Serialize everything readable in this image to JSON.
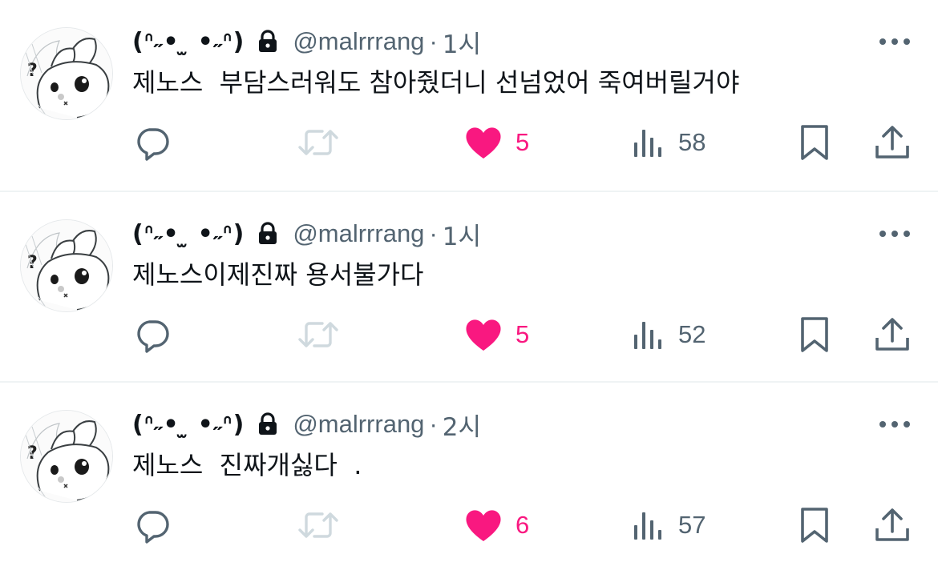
{
  "colors": {
    "like_pink": "#f91880",
    "secondary_gray": "#536471",
    "icon_gray": "#536471",
    "disabled_retweet": "#cfd9de",
    "divider": "#eff3f4"
  },
  "tweets": [
    {
      "display_name": "(ᐢ˶• ̫ •˶ᐢ)",
      "handle": "@malrrrang",
      "separator": "·",
      "time": "1시",
      "text": "제노스  부담스러워도 참아줬더니 선넘었어 죽여버릴거야",
      "like_count": "5",
      "view_count": "58",
      "icons": [
        "avatar-bunny",
        "lock-icon",
        "more-icon",
        "reply-icon",
        "retweet-icon",
        "heart-icon",
        "views-icon",
        "bookmark-icon",
        "share-icon"
      ]
    },
    {
      "display_name": "(ᐢ˶• ̫ •˶ᐢ)",
      "handle": "@malrrrang",
      "separator": "·",
      "time": "1시",
      "text": "제노스이제진짜 용서불가다",
      "like_count": "5",
      "view_count": "52"
    },
    {
      "display_name": "(ᐢ˶• ̫ •˶ᐢ)",
      "handle": "@malrrrang",
      "separator": "·",
      "time": "2시",
      "text": "제노스  진짜개싫다  .",
      "like_count": "6",
      "view_count": "57"
    }
  ]
}
